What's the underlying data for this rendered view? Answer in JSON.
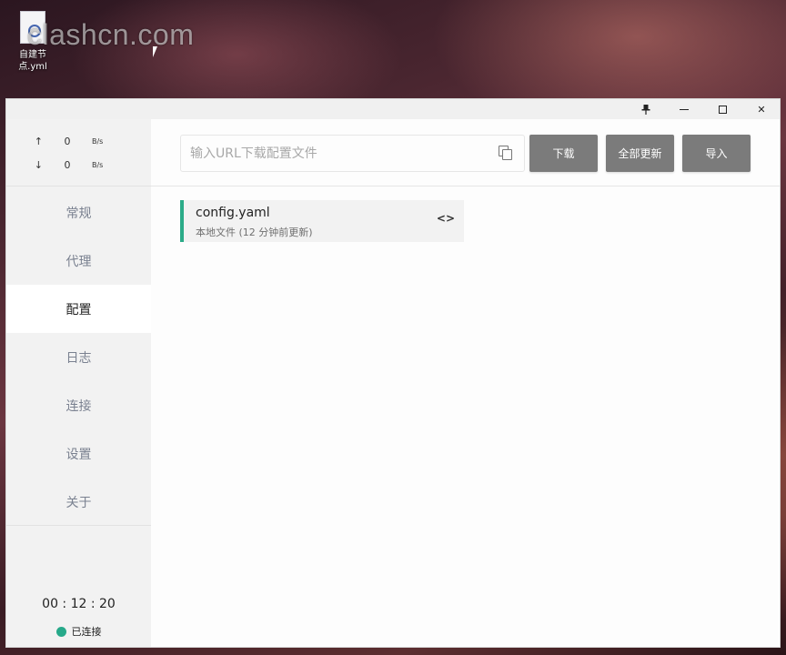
{
  "desktop": {
    "file_label": "自建节点.yml",
    "watermark": "clashcn.com"
  },
  "window": {
    "titlebar": {
      "pin_icon": "pin-icon",
      "min_icon": "minimize-icon",
      "max_icon": "maximize-icon",
      "close_glyph": "✕"
    },
    "traffic": {
      "up_arrow": "↑",
      "up_value": "0",
      "up_unit": "B/s",
      "down_arrow": "↓",
      "down_value": "0",
      "down_unit": "B/s"
    },
    "nav": [
      {
        "label": "常规"
      },
      {
        "label": "代理"
      },
      {
        "label": "配置"
      },
      {
        "label": "日志"
      },
      {
        "label": "连接"
      },
      {
        "label": "设置"
      },
      {
        "label": "关于"
      }
    ],
    "active_nav": "配置",
    "footer": {
      "uptime": "00 : 12 : 20",
      "status": "已连接",
      "status_color": "#27a98a"
    },
    "header": {
      "url_placeholder": "输入URL下载配置文件",
      "url_value": "",
      "download_label": "下载",
      "update_all_label": "全部更新",
      "import_label": "导入"
    },
    "profiles": [
      {
        "name": "config.yaml",
        "meta": "本地文件 (12 分钟前更新)",
        "edit_glyph": "<>",
        "accent": "#2bab88"
      }
    ]
  }
}
